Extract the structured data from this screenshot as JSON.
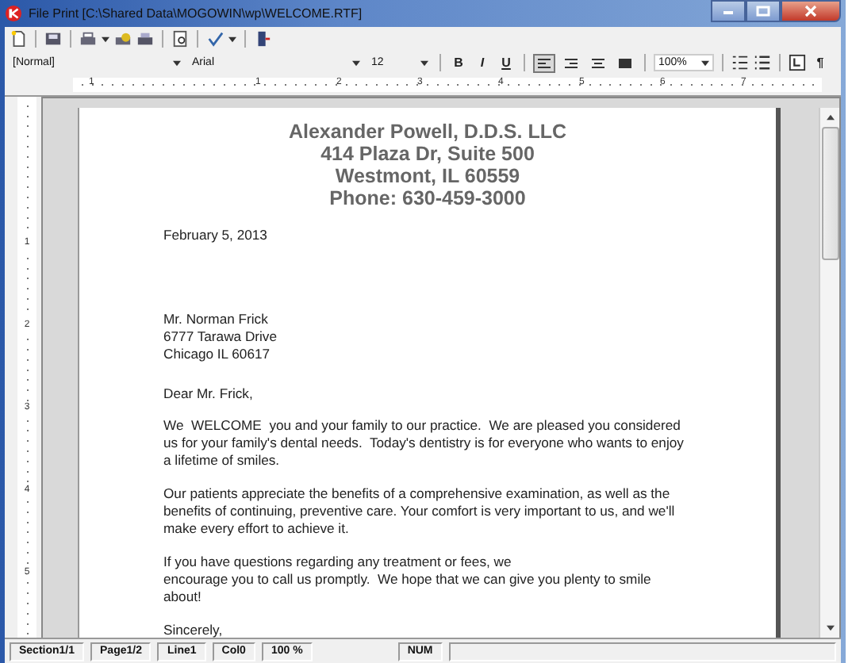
{
  "window": {
    "title": "File Print [C:\\Shared Data\\MOGOWIN\\wp\\WELCOME.RTF]"
  },
  "format_bar": {
    "style": "[Normal]",
    "font": "Arial",
    "size": "12",
    "zoom": "100%",
    "buttons": [
      {
        "kind": "text",
        "label": "B",
        "selected": false
      },
      {
        "kind": "text",
        "label": "I",
        "selected": false
      },
      {
        "kind": "text",
        "label": "U",
        "selected": false
      },
      {
        "kind": "align-left",
        "selected": true
      },
      {
        "kind": "align-right",
        "selected": false
      },
      {
        "kind": "align-center",
        "selected": false
      },
      {
        "kind": "justify",
        "selected": false
      }
    ],
    "pilcrow": "¶"
  },
  "ruler": {
    "marks": [
      "1",
      "1",
      "2",
      "3",
      "4",
      "5",
      "6",
      "7"
    ],
    "vertical_marks": [
      "1",
      "2",
      "3",
      "4",
      "5"
    ]
  },
  "document": {
    "letterhead": [
      "Alexander Powell, D.D.S. LLC",
      "414 Plaza Dr, Suite 500",
      "Westmont, IL 60559",
      "Phone: 630-459-3000"
    ],
    "date": "February 5, 2013",
    "address": [
      "Mr. Norman Frick",
      "6777 Tarawa Drive",
      "Chicago IL 60617"
    ],
    "salutation": "Dear Mr. Frick,",
    "paragraphs": [
      [
        "We  WELCOME  you and your family to our practice.  We are pleased you considered",
        "us for your family's dental needs.  Today's dentistry is for everyone who wants to enjoy",
        "a lifetime of smiles."
      ],
      [
        "Our patients appreciate the benefits of a comprehensive examination, as well as the",
        "benefits of continuing, preventive care. Your comfort is very important to us, and we'll",
        "make every effort to achieve it."
      ],
      [
        "If you have questions regarding any treatment or fees, we",
        "encourage you to call us promptly.  We hope that we can give you plenty to smile",
        "about!"
      ]
    ],
    "closing": "Sincerely,"
  },
  "status_bar": [
    "Section1/1",
    "Page1/2",
    "Line1",
    "Col0",
    "100 %",
    "NUM"
  ]
}
